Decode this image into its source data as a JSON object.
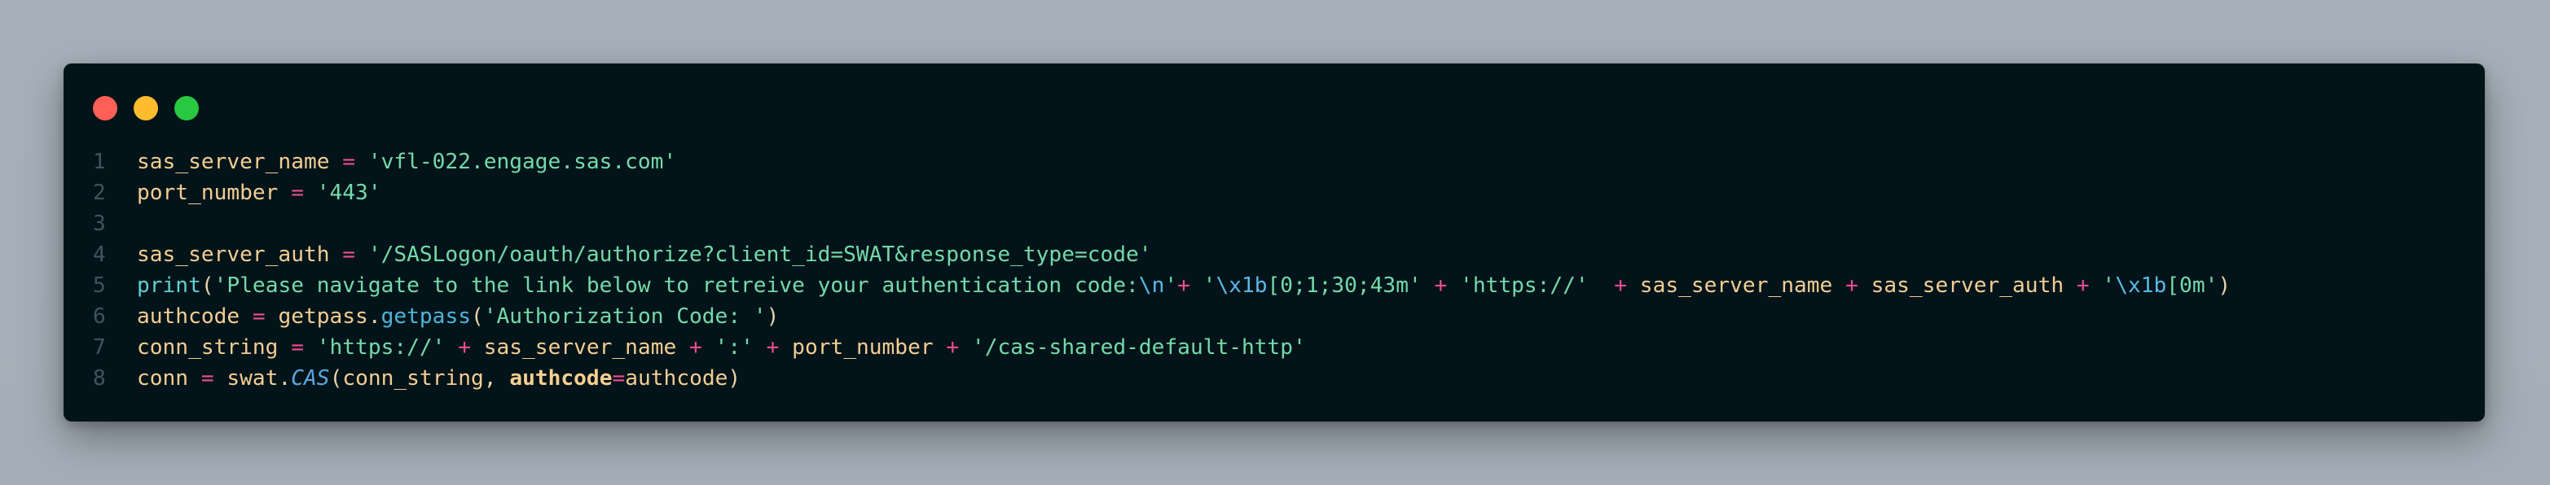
{
  "window": {
    "controls": [
      "close-dot",
      "minimize-dot",
      "maximize-dot"
    ],
    "colors": {
      "background": "#021419",
      "close": "#ff5f57",
      "minimize": "#febc2e",
      "maximize": "#28c840"
    }
  },
  "code": {
    "line_numbers": [
      "1",
      "2",
      "3",
      "4",
      "5",
      "6",
      "7",
      "8"
    ],
    "l1": {
      "var": "sas_server_name",
      "eq": " = ",
      "str": "'vfl-022.engage.sas.com'"
    },
    "l2": {
      "var": "port_number",
      "eq": " = ",
      "str": "'443'"
    },
    "l4": {
      "var": "sas_server_auth",
      "eq": " = ",
      "str": "'/SASLogon/oauth/authorize?client_id=SWAT&response_type=code'"
    },
    "l5": {
      "fn": "print",
      "open": "(",
      "str1": "'Please navigate to the link below to retreive your authentication code:",
      "esc1": "\\n",
      "str1_end": "'",
      "plus1": "+ ",
      "str2a": "'",
      "esc2": "\\x1b",
      "str2b": "[0;1;30;43m'",
      "plus2": " + ",
      "str3": "'https://'",
      "plus3": "  + ",
      "var1": "sas_server_name",
      "plus4": " + ",
      "var2": "sas_server_auth",
      "plus5": " + ",
      "str4a": "'",
      "esc4": "\\x1b",
      "str4b": "[0m'",
      "close": ")"
    },
    "l6": {
      "var": "authcode",
      "eq": " = ",
      "obj": "getpass",
      "dot": ".",
      "method": "getpass",
      "open": "(",
      "str": "'Authorization Code: '",
      "close": ")"
    },
    "l7": {
      "var": "conn_string",
      "eq": " = ",
      "str1": "'https://'",
      "plus1": " + ",
      "var1": "sas_server_name",
      "plus2": " + ",
      "str2": "':'",
      "plus3": " + ",
      "var2": "port_number",
      "plus4": " + ",
      "str3": "'/cas-shared-default-http'"
    },
    "l8": {
      "var": "conn",
      "eq": " = ",
      "obj": "swat",
      "dot": ".",
      "cls": "CAS",
      "open": "(",
      "arg1": "conn_string",
      "comma": ", ",
      "kw": "authcode",
      "kweq": "=",
      "arg2": "authcode",
      "close": ")"
    }
  }
}
